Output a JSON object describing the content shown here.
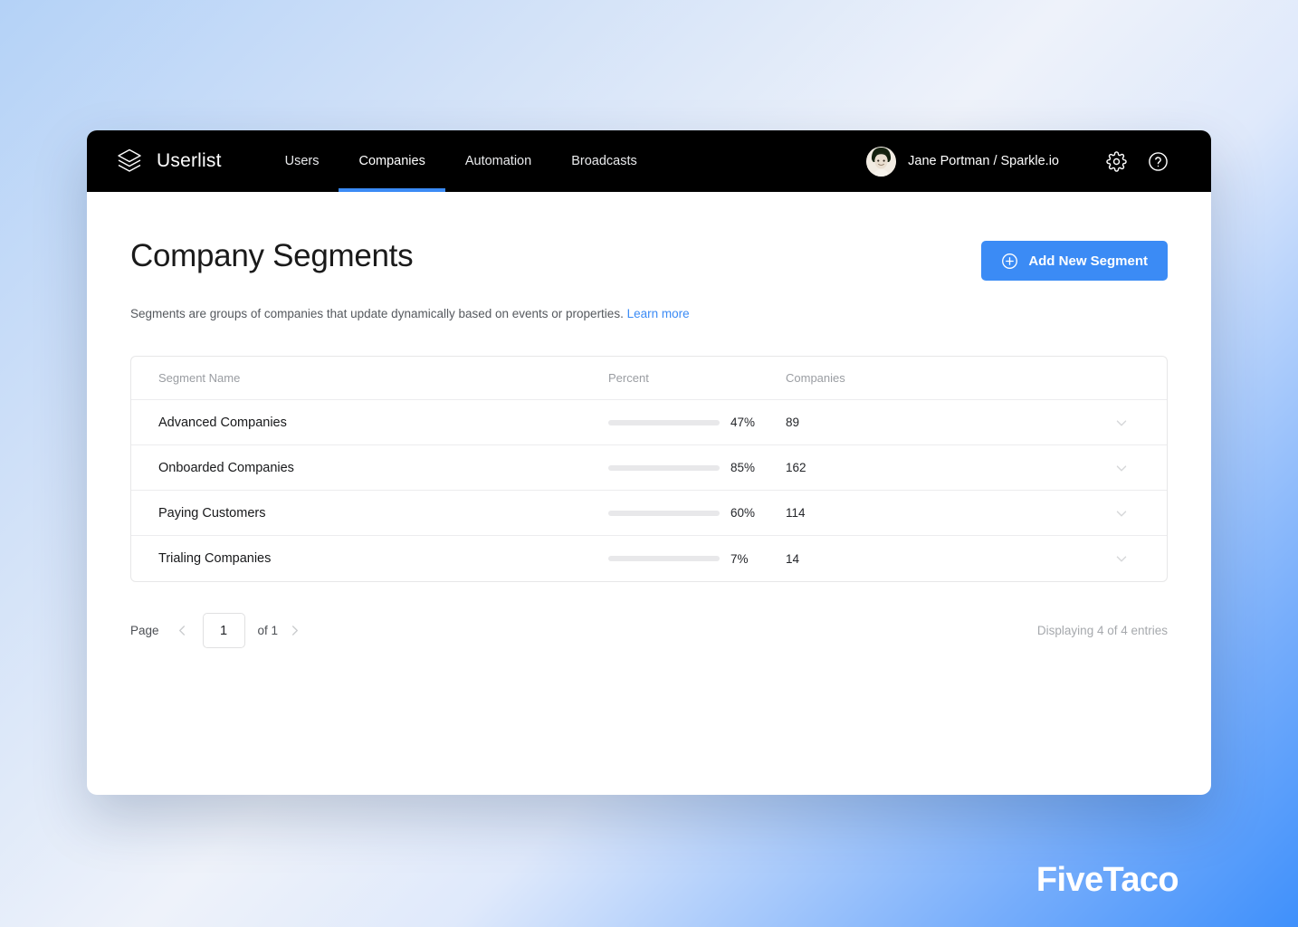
{
  "navbar": {
    "brand_icon": "layers-icon",
    "brand_name": "Userlist",
    "tabs": [
      {
        "label": "Users",
        "active": false
      },
      {
        "label": "Companies",
        "active": true
      },
      {
        "label": "Automation",
        "active": false
      },
      {
        "label": "Broadcasts",
        "active": false
      }
    ],
    "user": {
      "avatar": "user-avatar-photo",
      "name": "Jane Portman / Sparkle.io"
    },
    "settings_icon": "gear-icon",
    "help_icon": "question-circle-icon",
    "accent_color": "#3b8bf5",
    "background_color": "#000000"
  },
  "page": {
    "title": "Company Segments",
    "description_text": "Segments are groups of companies that update dynamically based on events or properties.",
    "description_link": "Learn more",
    "add_button": {
      "label": "Add New Segment",
      "icon": "plus-circle-icon",
      "color": "#3b8bf5"
    }
  },
  "table": {
    "columns": [
      "Segment Name",
      "Percent",
      "Companies"
    ],
    "row_icon": "chevron-down-icon",
    "rows": [
      {
        "name": "Advanced Companies",
        "percent": 47,
        "percent_label": "47%",
        "companies": "89"
      },
      {
        "name": "Onboarded Companies",
        "percent": 85,
        "percent_label": "85%",
        "companies": "162"
      },
      {
        "name": "Paying Customers",
        "percent": 60,
        "percent_label": "60%",
        "companies": "114"
      },
      {
        "name": "Trialing Companies",
        "percent": 7,
        "percent_label": "7%",
        "companies": "14"
      }
    ]
  },
  "footer": {
    "page_label": "Page",
    "page_value": "1",
    "of_label": "of 1",
    "prev_icon": "chevron-left-icon",
    "next_icon": "chevron-right-icon",
    "entries": "Displaying 4 of 4 entries"
  },
  "watermark": "FiveTaco"
}
